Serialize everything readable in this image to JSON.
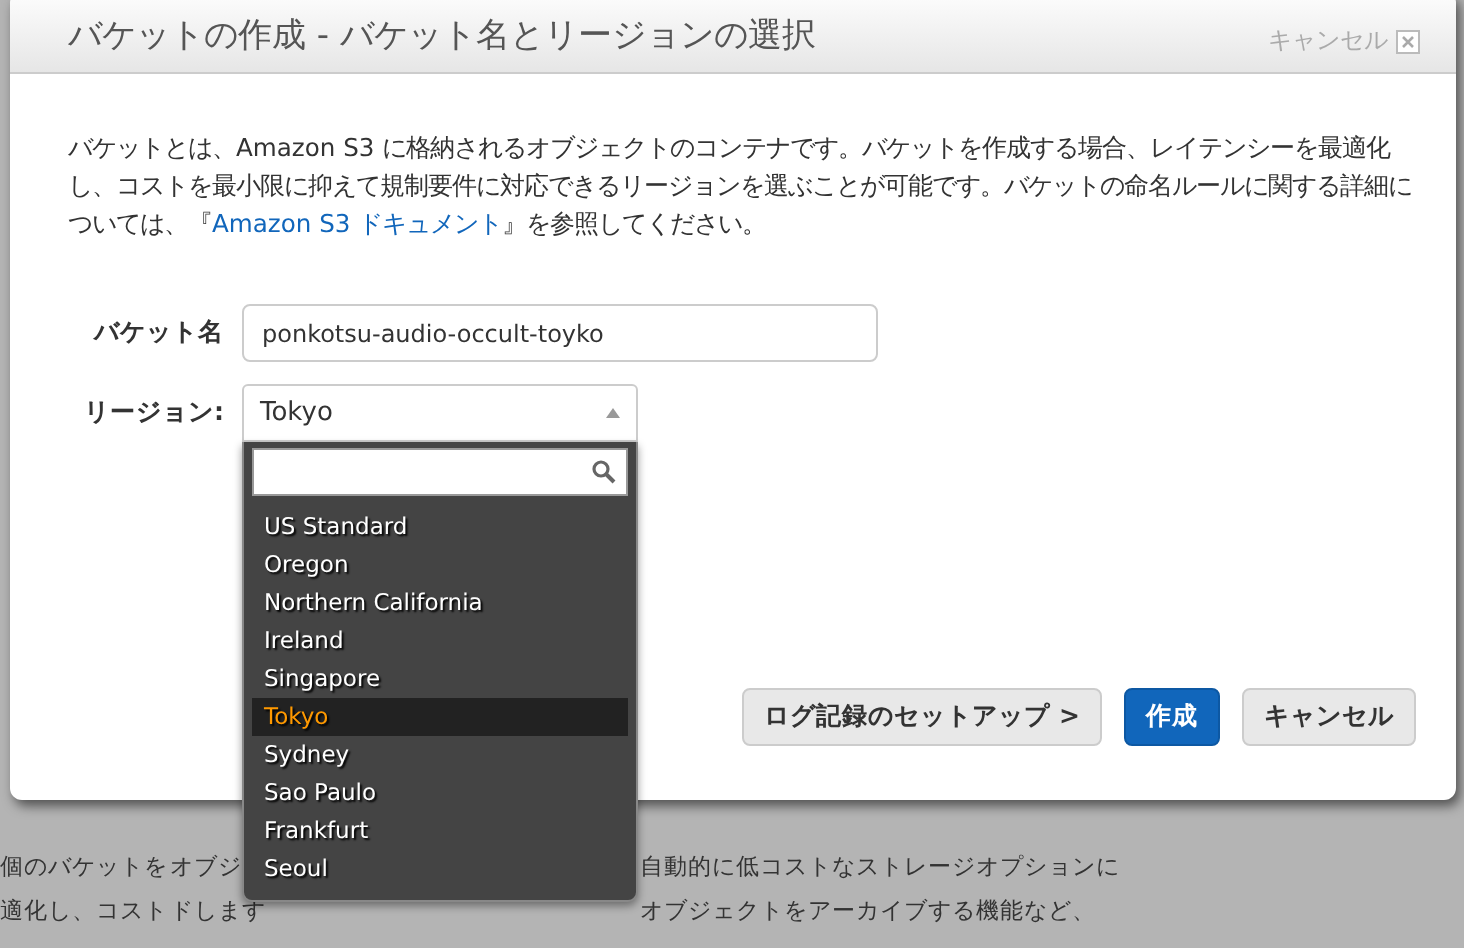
{
  "background": {
    "rows": [
      {
        "cells": [
          "個のバケットを",
          "オブジ",
          "自動的に低コストなストレージオプションに"
        ]
      },
      {
        "cells": [
          "適化し、コスト",
          "ドします",
          "オブジェクトをアーカイブする機能など、"
        ]
      }
    ]
  },
  "dialog": {
    "title": "バケットの作成 - バケット名とリージョンの選択",
    "close_label": "キャンセル",
    "description": {
      "before": "バケットとは、Amazon S3 に格納されるオブジェクトのコンテナです。バケットを作成する場合、レイテンシーを最適化し、コストを最小限に抑えて規制要件に対応できるリージョンを選ぶことが可能です。バケットの命名ルールに関する詳細については、『",
      "link": "Amazon S3 ドキュメント",
      "after": "』を参照してください。"
    },
    "bucket_name": {
      "label": "バケット名",
      "value": "ponkotsu-audio-occult-toyko"
    },
    "region": {
      "label": "リージョン:",
      "value": "Tokyo",
      "expanded": true,
      "options": [
        {
          "label": "US Standard",
          "selected": false
        },
        {
          "label": "Oregon",
          "selected": false
        },
        {
          "label": "Northern California",
          "selected": false
        },
        {
          "label": "Ireland",
          "selected": false
        },
        {
          "label": "Singapore",
          "selected": false
        },
        {
          "label": "Tokyo",
          "selected": true
        },
        {
          "label": "Sydney",
          "selected": false
        },
        {
          "label": "Sao Paulo",
          "selected": false
        },
        {
          "label": "Frankfurt",
          "selected": false
        },
        {
          "label": "Seoul",
          "selected": false
        }
      ]
    },
    "buttons": [
      {
        "label": "ログ記録のセットアップ >",
        "kind": "secondary"
      },
      {
        "label": "作成",
        "kind": "primary"
      },
      {
        "label": "キャンセル",
        "kind": "secondary"
      }
    ]
  }
}
